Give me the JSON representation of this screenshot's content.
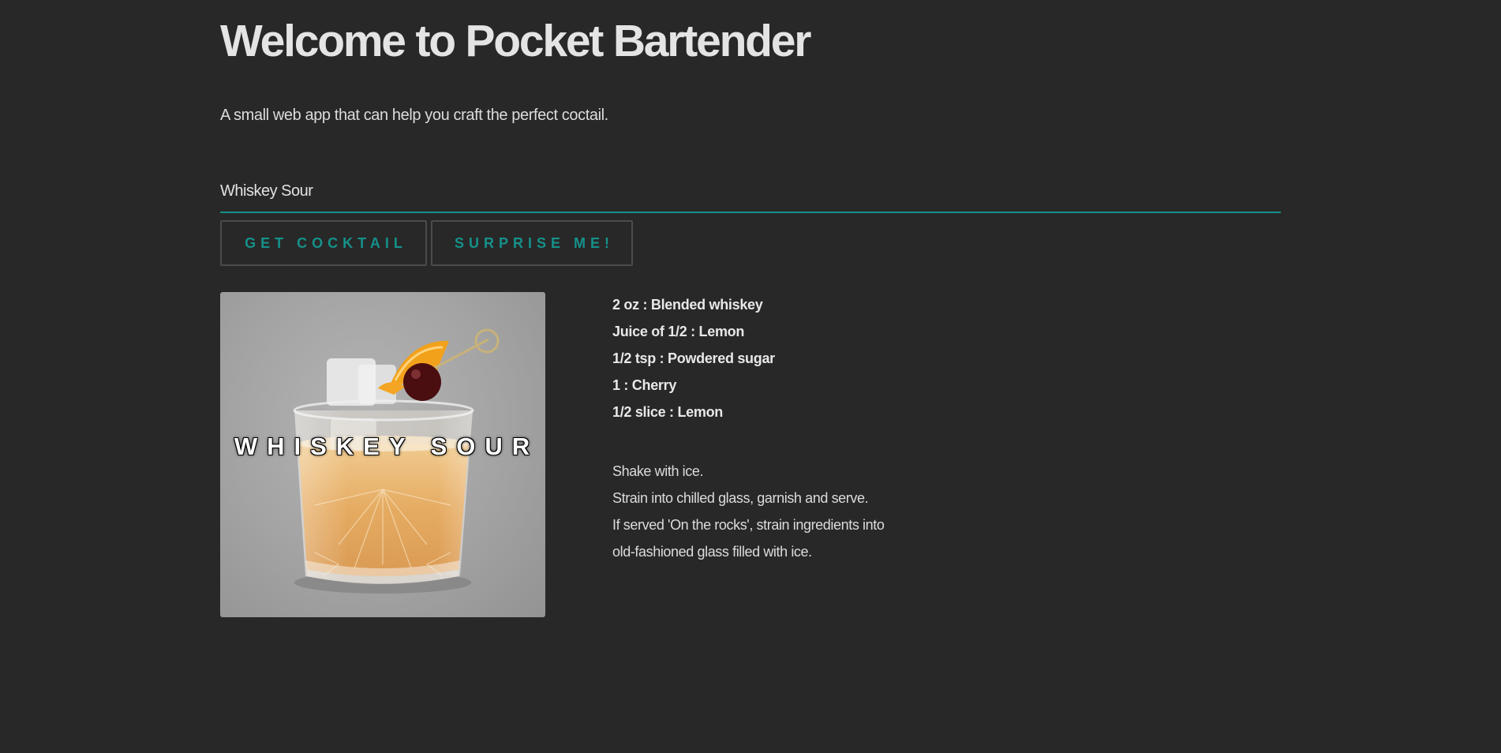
{
  "header": {
    "title": "Welcome to Pocket Bartender",
    "subtitle": "A small web app that can help you craft the perfect coctail."
  },
  "search": {
    "value": "Whiskey Sour",
    "placeholder": ""
  },
  "actions": {
    "get_cocktail_label": "GET COCKTAIL",
    "surprise_label": "SURPRISE ME!"
  },
  "drink": {
    "name": "WHISKEY SOUR",
    "ingredients": [
      "2 oz : Blended whiskey",
      "Juice of 1/2 : Lemon",
      "1/2 tsp : Powdered sugar",
      "1 : Cherry",
      "1/2 slice : Lemon"
    ],
    "instructions": [
      "Shake with ice.",
      "Strain into chilled glass, garnish and serve.",
      "If served 'On the rocks', strain ingredients into",
      "old-fashioned glass filled with ice."
    ]
  },
  "colors": {
    "background": "#282828",
    "accent": "#15918a",
    "text": "#e6e6e6",
    "button_border": "#4b4b4b"
  }
}
